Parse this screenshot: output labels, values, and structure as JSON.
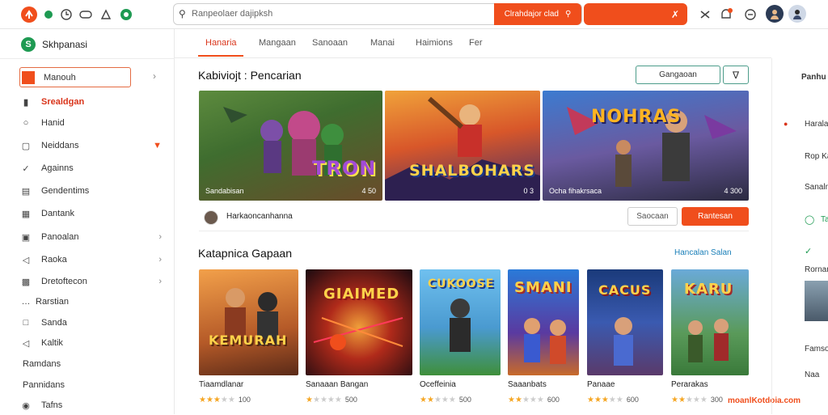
{
  "search": {
    "placeholder": "Ranpeolaer dajipksh",
    "button_label": "Clrahdajor clad"
  },
  "top_actions": {
    "cta_icon": "wrench-icon"
  },
  "sidebar": {
    "brand": "Skhpanasi",
    "items": [
      {
        "label": "Manouh",
        "icon": "square-icon"
      },
      {
        "label": "Srealdgan",
        "icon": "folder-icon"
      },
      {
        "label": "Hanid",
        "icon": "chat-icon"
      },
      {
        "label": "Neiddans",
        "icon": "monitor-icon"
      },
      {
        "label": "Againns",
        "icon": "tool-icon"
      },
      {
        "label": "Gendentims",
        "icon": "card-icon"
      },
      {
        "label": "Dantank",
        "icon": "calendar-icon"
      },
      {
        "label": "Panoalan",
        "icon": "panel-icon"
      },
      {
        "label": "Raoka",
        "icon": "tag-icon"
      },
      {
        "label": "Dretoftecon",
        "icon": "grid-icon"
      },
      {
        "label": "Rarstian",
        "icon": "list-icon"
      },
      {
        "label": "Sanda",
        "icon": "box-icon"
      },
      {
        "label": "Kaltik",
        "icon": "tag-icon"
      },
      {
        "label": "Ramdans",
        "icon": "none"
      },
      {
        "label": "Pannidans",
        "icon": "none"
      },
      {
        "label": "Tafns",
        "icon": "globe-icon"
      }
    ]
  },
  "tabs": [
    "Hanaria",
    "Mangaan",
    "Sanoaan",
    "Manai",
    "Haimions",
    "Fer"
  ],
  "featured": {
    "title": "Kabiviojt : Pencarian",
    "filter_label": "Gangaoan",
    "cards": [
      {
        "title": "TRON",
        "caption": "Sandabisan",
        "count": "4 50"
      },
      {
        "title": "SHALBOHARS",
        "caption": "",
        "count": "0 3"
      },
      {
        "title": "NOHRAS",
        "caption": "Ocha fihakrsaca",
        "count": "4 300"
      }
    ]
  },
  "creator": {
    "name": "Harkaoncanhanna",
    "secondary_button": "Saocaan",
    "primary_button": "Rantesan"
  },
  "popular": {
    "title": "Katapnica Gapaan",
    "link": "Hancalan Salan",
    "games": [
      {
        "name": "Tiaamdlanar",
        "rating": 3,
        "count": "100",
        "title": "KEMURAH"
      },
      {
        "name": "Sanaaan Bangan",
        "rating": 1,
        "count": "500",
        "title": "GIAIMED"
      },
      {
        "name": "Oceffeinia",
        "rating": 2,
        "count": "500",
        "title": "CUKOOSE"
      },
      {
        "name": "Saaanbats",
        "rating": 2,
        "count": "600",
        "title": "SMANI"
      },
      {
        "name": "Panaae",
        "rating": 3,
        "count": "600",
        "title": "CACUS"
      },
      {
        "name": "Perarakas",
        "rating": 2,
        "count": "300",
        "title": "KARU"
      }
    ]
  },
  "right_pane": {
    "heading": "Panhu",
    "items": [
      "Haralan",
      "Rop Kan",
      "Sanaln",
      "Tao",
      "Rornan",
      "Famso",
      "Naa"
    ]
  },
  "watermark": "moanlKotdoia.com",
  "colors": {
    "accent": "#f04e1c",
    "brand": "#1e9a52",
    "stars": "#f5a623"
  }
}
